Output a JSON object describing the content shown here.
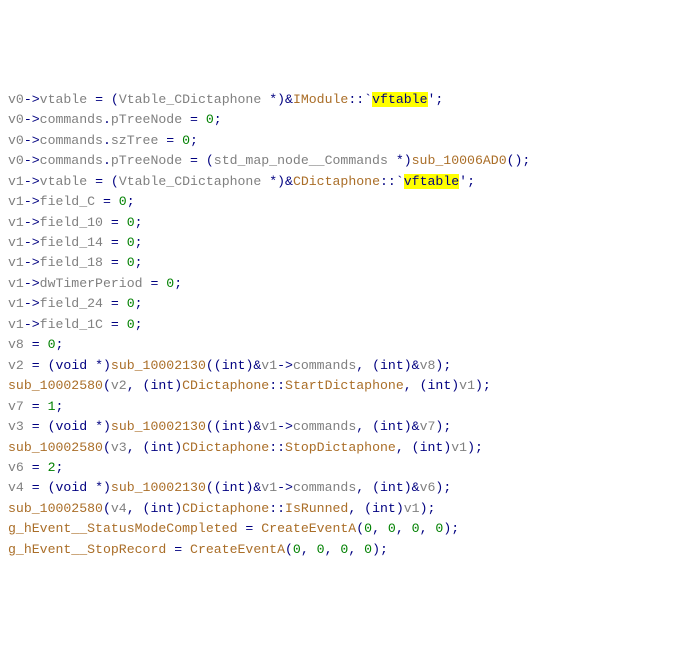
{
  "code": {
    "lines": [
      {
        "segs": [
          {
            "t": "v0",
            "c": "gray"
          },
          {
            "t": "->",
            "c": "blue"
          },
          {
            "t": "vtable ",
            "c": "gray"
          },
          {
            "t": "= (",
            "c": "blue"
          },
          {
            "t": "Vtable_CDictaphone ",
            "c": "gray"
          },
          {
            "t": "*)&",
            "c": "blue"
          },
          {
            "t": "IModule",
            "c": "brown"
          },
          {
            "t": "::`",
            "c": "blue"
          },
          {
            "t": "vftable",
            "c": "hl"
          },
          {
            "t": "';",
            "c": "blue"
          }
        ]
      },
      {
        "segs": [
          {
            "t": "v0",
            "c": "gray"
          },
          {
            "t": "->",
            "c": "blue"
          },
          {
            "t": "commands",
            "c": "gray"
          },
          {
            "t": ".",
            "c": "blue"
          },
          {
            "t": "pTreeNode ",
            "c": "gray"
          },
          {
            "t": "= ",
            "c": "blue"
          },
          {
            "t": "0",
            "c": "num"
          },
          {
            "t": ";",
            "c": "blue"
          }
        ]
      },
      {
        "segs": [
          {
            "t": "v0",
            "c": "gray"
          },
          {
            "t": "->",
            "c": "blue"
          },
          {
            "t": "commands",
            "c": "gray"
          },
          {
            "t": ".",
            "c": "blue"
          },
          {
            "t": "szTree ",
            "c": "gray"
          },
          {
            "t": "= ",
            "c": "blue"
          },
          {
            "t": "0",
            "c": "num"
          },
          {
            "t": ";",
            "c": "blue"
          }
        ]
      },
      {
        "segs": [
          {
            "t": "v0",
            "c": "gray"
          },
          {
            "t": "->",
            "c": "blue"
          },
          {
            "t": "commands",
            "c": "gray"
          },
          {
            "t": ".",
            "c": "blue"
          },
          {
            "t": "pTreeNode ",
            "c": "gray"
          },
          {
            "t": "= (",
            "c": "blue"
          },
          {
            "t": "std_map_node__Commands ",
            "c": "gray"
          },
          {
            "t": "*)",
            "c": "blue"
          },
          {
            "t": "sub_10006AD0",
            "c": "brown"
          },
          {
            "t": "();",
            "c": "blue"
          }
        ]
      },
      {
        "segs": [
          {
            "t": "v1",
            "c": "gray"
          },
          {
            "t": "->",
            "c": "blue"
          },
          {
            "t": "vtable ",
            "c": "gray"
          },
          {
            "t": "= (",
            "c": "blue"
          },
          {
            "t": "Vtable_CDictaphone ",
            "c": "gray"
          },
          {
            "t": "*)&",
            "c": "blue"
          },
          {
            "t": "CDictaphone",
            "c": "brown"
          },
          {
            "t": "::`",
            "c": "blue"
          },
          {
            "t": "vftable",
            "c": "hl"
          },
          {
            "t": "';",
            "c": "blue"
          }
        ]
      },
      {
        "segs": [
          {
            "t": "v1",
            "c": "gray"
          },
          {
            "t": "->",
            "c": "blue"
          },
          {
            "t": "field_C ",
            "c": "gray"
          },
          {
            "t": "= ",
            "c": "blue"
          },
          {
            "t": "0",
            "c": "num"
          },
          {
            "t": ";",
            "c": "blue"
          }
        ]
      },
      {
        "segs": [
          {
            "t": "v1",
            "c": "gray"
          },
          {
            "t": "->",
            "c": "blue"
          },
          {
            "t": "field_10 ",
            "c": "gray"
          },
          {
            "t": "= ",
            "c": "blue"
          },
          {
            "t": "0",
            "c": "num"
          },
          {
            "t": ";",
            "c": "blue"
          }
        ]
      },
      {
        "segs": [
          {
            "t": "v1",
            "c": "gray"
          },
          {
            "t": "->",
            "c": "blue"
          },
          {
            "t": "field_14 ",
            "c": "gray"
          },
          {
            "t": "= ",
            "c": "blue"
          },
          {
            "t": "0",
            "c": "num"
          },
          {
            "t": ";",
            "c": "blue"
          }
        ]
      },
      {
        "segs": [
          {
            "t": "v1",
            "c": "gray"
          },
          {
            "t": "->",
            "c": "blue"
          },
          {
            "t": "field_18 ",
            "c": "gray"
          },
          {
            "t": "= ",
            "c": "blue"
          },
          {
            "t": "0",
            "c": "num"
          },
          {
            "t": ";",
            "c": "blue"
          }
        ]
      },
      {
        "segs": [
          {
            "t": "v1",
            "c": "gray"
          },
          {
            "t": "->",
            "c": "blue"
          },
          {
            "t": "dwTimerPeriod ",
            "c": "gray"
          },
          {
            "t": "= ",
            "c": "blue"
          },
          {
            "t": "0",
            "c": "num"
          },
          {
            "t": ";",
            "c": "blue"
          }
        ]
      },
      {
        "segs": [
          {
            "t": "v1",
            "c": "gray"
          },
          {
            "t": "->",
            "c": "blue"
          },
          {
            "t": "field_24 ",
            "c": "gray"
          },
          {
            "t": "= ",
            "c": "blue"
          },
          {
            "t": "0",
            "c": "num"
          },
          {
            "t": ";",
            "c": "blue"
          }
        ]
      },
      {
        "segs": [
          {
            "t": "v1",
            "c": "gray"
          },
          {
            "t": "->",
            "c": "blue"
          },
          {
            "t": "field_1C ",
            "c": "gray"
          },
          {
            "t": "= ",
            "c": "blue"
          },
          {
            "t": "0",
            "c": "num"
          },
          {
            "t": ";",
            "c": "blue"
          }
        ]
      },
      {
        "segs": [
          {
            "t": "v8 ",
            "c": "gray"
          },
          {
            "t": "= ",
            "c": "blue"
          },
          {
            "t": "0",
            "c": "num"
          },
          {
            "t": ";",
            "c": "blue"
          }
        ]
      },
      {
        "segs": [
          {
            "t": "v2 ",
            "c": "gray"
          },
          {
            "t": "= (",
            "c": "blue"
          },
          {
            "t": "void ",
            "c": "blue"
          },
          {
            "t": "*)",
            "c": "blue"
          },
          {
            "t": "sub_10002130",
            "c": "brown"
          },
          {
            "t": "((",
            "c": "blue"
          },
          {
            "t": "int",
            "c": "blue"
          },
          {
            "t": ")&",
            "c": "blue"
          },
          {
            "t": "v1",
            "c": "gray"
          },
          {
            "t": "->",
            "c": "blue"
          },
          {
            "t": "commands",
            "c": "gray"
          },
          {
            "t": ", (",
            "c": "blue"
          },
          {
            "t": "int",
            "c": "blue"
          },
          {
            "t": ")&",
            "c": "blue"
          },
          {
            "t": "v8",
            "c": "gray"
          },
          {
            "t": ");",
            "c": "blue"
          }
        ]
      },
      {
        "segs": [
          {
            "t": "sub_10002580",
            "c": "brown"
          },
          {
            "t": "(",
            "c": "blue"
          },
          {
            "t": "v2",
            "c": "gray"
          },
          {
            "t": ", (",
            "c": "blue"
          },
          {
            "t": "int",
            "c": "blue"
          },
          {
            "t": ")",
            "c": "blue"
          },
          {
            "t": "CDictaphone",
            "c": "brown"
          },
          {
            "t": "::",
            "c": "blue"
          },
          {
            "t": "StartDictaphone",
            "c": "brown"
          },
          {
            "t": ", (",
            "c": "blue"
          },
          {
            "t": "int",
            "c": "blue"
          },
          {
            "t": ")",
            "c": "blue"
          },
          {
            "t": "v1",
            "c": "gray"
          },
          {
            "t": ");",
            "c": "blue"
          }
        ]
      },
      {
        "segs": [
          {
            "t": "v7 ",
            "c": "gray"
          },
          {
            "t": "= ",
            "c": "blue"
          },
          {
            "t": "1",
            "c": "num"
          },
          {
            "t": ";",
            "c": "blue"
          }
        ]
      },
      {
        "segs": [
          {
            "t": "v3 ",
            "c": "gray"
          },
          {
            "t": "= (",
            "c": "blue"
          },
          {
            "t": "void ",
            "c": "blue"
          },
          {
            "t": "*)",
            "c": "blue"
          },
          {
            "t": "sub_10002130",
            "c": "brown"
          },
          {
            "t": "((",
            "c": "blue"
          },
          {
            "t": "int",
            "c": "blue"
          },
          {
            "t": ")&",
            "c": "blue"
          },
          {
            "t": "v1",
            "c": "gray"
          },
          {
            "t": "->",
            "c": "blue"
          },
          {
            "t": "commands",
            "c": "gray"
          },
          {
            "t": ", (",
            "c": "blue"
          },
          {
            "t": "int",
            "c": "blue"
          },
          {
            "t": ")&",
            "c": "blue"
          },
          {
            "t": "v7",
            "c": "gray"
          },
          {
            "t": ");",
            "c": "blue"
          }
        ]
      },
      {
        "segs": [
          {
            "t": "sub_10002580",
            "c": "brown"
          },
          {
            "t": "(",
            "c": "blue"
          },
          {
            "t": "v3",
            "c": "gray"
          },
          {
            "t": ", (",
            "c": "blue"
          },
          {
            "t": "int",
            "c": "blue"
          },
          {
            "t": ")",
            "c": "blue"
          },
          {
            "t": "CDictaphone",
            "c": "brown"
          },
          {
            "t": "::",
            "c": "blue"
          },
          {
            "t": "StopDictaphone",
            "c": "brown"
          },
          {
            "t": ", (",
            "c": "blue"
          },
          {
            "t": "int",
            "c": "blue"
          },
          {
            "t": ")",
            "c": "blue"
          },
          {
            "t": "v1",
            "c": "gray"
          },
          {
            "t": ");",
            "c": "blue"
          }
        ]
      },
      {
        "segs": [
          {
            "t": "v6 ",
            "c": "gray"
          },
          {
            "t": "= ",
            "c": "blue"
          },
          {
            "t": "2",
            "c": "num"
          },
          {
            "t": ";",
            "c": "blue"
          }
        ]
      },
      {
        "segs": [
          {
            "t": "v4 ",
            "c": "gray"
          },
          {
            "t": "= (",
            "c": "blue"
          },
          {
            "t": "void ",
            "c": "blue"
          },
          {
            "t": "*)",
            "c": "blue"
          },
          {
            "t": "sub_10002130",
            "c": "brown"
          },
          {
            "t": "((",
            "c": "blue"
          },
          {
            "t": "int",
            "c": "blue"
          },
          {
            "t": ")&",
            "c": "blue"
          },
          {
            "t": "v1",
            "c": "gray"
          },
          {
            "t": "->",
            "c": "blue"
          },
          {
            "t": "commands",
            "c": "gray"
          },
          {
            "t": ", (",
            "c": "blue"
          },
          {
            "t": "int",
            "c": "blue"
          },
          {
            "t": ")&",
            "c": "blue"
          },
          {
            "t": "v6",
            "c": "gray"
          },
          {
            "t": ");",
            "c": "blue"
          }
        ]
      },
      {
        "segs": [
          {
            "t": "sub_10002580",
            "c": "brown"
          },
          {
            "t": "(",
            "c": "blue"
          },
          {
            "t": "v4",
            "c": "gray"
          },
          {
            "t": ", (",
            "c": "blue"
          },
          {
            "t": "int",
            "c": "blue"
          },
          {
            "t": ")",
            "c": "blue"
          },
          {
            "t": "CDictaphone",
            "c": "brown"
          },
          {
            "t": "::",
            "c": "blue"
          },
          {
            "t": "IsRunned",
            "c": "brown"
          },
          {
            "t": ", (",
            "c": "blue"
          },
          {
            "t": "int",
            "c": "blue"
          },
          {
            "t": ")",
            "c": "blue"
          },
          {
            "t": "v1",
            "c": "gray"
          },
          {
            "t": ");",
            "c": "blue"
          }
        ]
      },
      {
        "segs": [
          {
            "t": "g_hEvent__StatusModeCompleted ",
            "c": "brown"
          },
          {
            "t": "= ",
            "c": "blue"
          },
          {
            "t": "CreateEventA",
            "c": "brown"
          },
          {
            "t": "(",
            "c": "blue"
          },
          {
            "t": "0",
            "c": "num"
          },
          {
            "t": ", ",
            "c": "blue"
          },
          {
            "t": "0",
            "c": "num"
          },
          {
            "t": ", ",
            "c": "blue"
          },
          {
            "t": "0",
            "c": "num"
          },
          {
            "t": ", ",
            "c": "blue"
          },
          {
            "t": "0",
            "c": "num"
          },
          {
            "t": ");",
            "c": "blue"
          }
        ]
      },
      {
        "segs": [
          {
            "t": "g_hEvent__StopRecord ",
            "c": "brown"
          },
          {
            "t": "= ",
            "c": "blue"
          },
          {
            "t": "CreateEventA",
            "c": "brown"
          },
          {
            "t": "(",
            "c": "blue"
          },
          {
            "t": "0",
            "c": "num"
          },
          {
            "t": ", ",
            "c": "blue"
          },
          {
            "t": "0",
            "c": "num"
          },
          {
            "t": ", ",
            "c": "blue"
          },
          {
            "t": "0",
            "c": "num"
          },
          {
            "t": ", ",
            "c": "blue"
          },
          {
            "t": "0",
            "c": "num"
          },
          {
            "t": ");",
            "c": "blue"
          }
        ]
      }
    ]
  }
}
